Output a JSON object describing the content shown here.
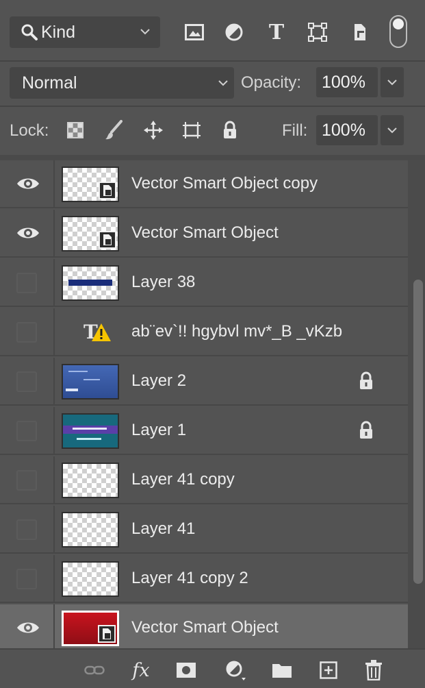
{
  "filter": {
    "kind_label": "Kind",
    "icons": [
      "pixel-layer-filter-icon",
      "adjustment-layer-filter-icon",
      "type-layer-filter-icon",
      "shape-layer-filter-icon",
      "smart-object-filter-icon"
    ]
  },
  "blend": {
    "mode": "Normal"
  },
  "opacity": {
    "label": "Opacity:",
    "value": "100%"
  },
  "lock": {
    "label": "Lock:"
  },
  "fill": {
    "label": "Fill:",
    "value": "100%"
  },
  "layers": [
    {
      "name": "Vector Smart Object copy",
      "visible": true,
      "thumb": "checker-smart"
    },
    {
      "name": "Vector Smart Object",
      "visible": true,
      "thumb": "checker-smart"
    },
    {
      "name": "Layer 38",
      "visible": false,
      "thumb": "navy-bar"
    },
    {
      "name": "ab¨ev`!! hgybvl mv*_B _vKzb",
      "visible": false,
      "thumb": "type-warning"
    },
    {
      "name": "Layer 2",
      "visible": false,
      "thumb": "blue-screen",
      "locked": true
    },
    {
      "name": "Layer 1",
      "visible": false,
      "thumb": "teal-screen",
      "locked": true
    },
    {
      "name": "Layer 41 copy",
      "visible": false,
      "thumb": "checker"
    },
    {
      "name": "Layer 41",
      "visible": false,
      "thumb": "checker"
    },
    {
      "name": "Layer 41 copy 2",
      "visible": false,
      "thumb": "checker"
    },
    {
      "name": "Vector Smart Object",
      "visible": true,
      "thumb": "red-smart",
      "selected": true
    }
  ],
  "colors": {
    "panel_bg": "#535353",
    "field_bg": "#454545",
    "selected_row": "#6a6a6a",
    "text": "#e6e6e6",
    "navy": "#1a2d7a",
    "red": "#b3121b",
    "warning_yellow": "#f5c400"
  },
  "bottom_bar": {
    "icons": [
      "link-layers-icon",
      "fx-icon",
      "layer-mask-icon",
      "adjustment-layer-icon",
      "group-folder-icon",
      "new-layer-icon",
      "trash-icon"
    ],
    "fx_label": "fx"
  }
}
